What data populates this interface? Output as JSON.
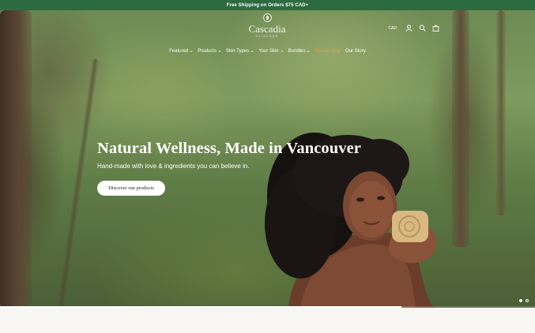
{
  "announcement": {
    "text": "Free Shipping on Orders $75 CAD+"
  },
  "brand": {
    "name": "Cascadia",
    "tagline": "SKINCARE"
  },
  "header": {
    "currency": "CAD"
  },
  "icons": {
    "account": "user-icon",
    "search": "search-icon",
    "cart": "bag-icon",
    "dropdown": "chevron-down-icon"
  },
  "nav": {
    "items": [
      {
        "label": "Featured",
        "dropdown": true
      },
      {
        "label": "Products",
        "dropdown": true
      },
      {
        "label": "Skin Types",
        "dropdown": true
      },
      {
        "label": "Your Skin",
        "dropdown": true
      },
      {
        "label": "Bundles",
        "dropdown": true
      },
      {
        "label": "Glacier Clay",
        "dropdown": false
      },
      {
        "label": "Our Story",
        "dropdown": false
      }
    ]
  },
  "hero": {
    "title": "Natural Wellness, Made in Vancouver",
    "subtitle": "Hand-made with love & ingredients you can believe in.",
    "cta_label": "Discover our products",
    "slide_count": 2,
    "active_slide": 1,
    "progress": 0.75
  },
  "colors": {
    "announcement_bg": "#2c6a3f",
    "accent_nav": "#f2a23c",
    "text_light": "#ffffff"
  }
}
